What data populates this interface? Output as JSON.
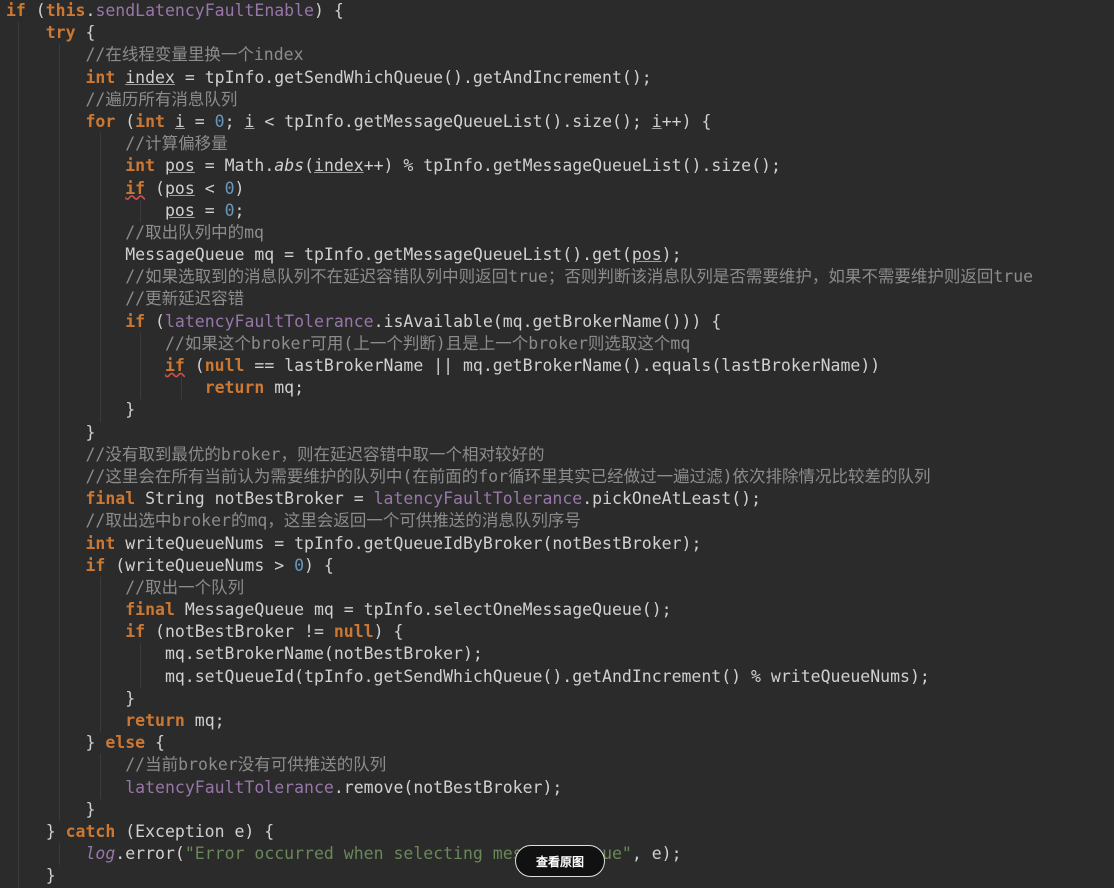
{
  "colors": {
    "background": "#2b2b2b",
    "keyword": "#cc7832",
    "field": "#9876aa",
    "number": "#6897bb",
    "string": "#6a8759",
    "comment": "#8c8c8c",
    "plain": "#d0d0d0"
  },
  "code": {
    "language": "java",
    "lines": [
      [
        {
          "t": "if",
          "c": "kw"
        },
        {
          "t": " ("
        },
        {
          "t": "this",
          "c": "kw"
        },
        {
          "t": "."
        },
        {
          "t": "sendLatencyFaultEnable",
          "c": "fld"
        },
        {
          "t": ") {"
        }
      ],
      [
        {
          "t": "    "
        },
        {
          "t": "try",
          "c": "kw"
        },
        {
          "t": " {"
        }
      ],
      [
        {
          "t": "        "
        },
        {
          "t": "//在线程变量里换一个index",
          "c": "cmt"
        }
      ],
      [
        {
          "t": "        "
        },
        {
          "t": "int",
          "c": "kw"
        },
        {
          "t": " "
        },
        {
          "t": "index",
          "c": "ul"
        },
        {
          "t": " = tpInfo.getSendWhichQueue().getAndIncrement();"
        }
      ],
      [
        {
          "t": "        "
        },
        {
          "t": "//遍历所有消息队列",
          "c": "cmt"
        }
      ],
      [
        {
          "t": "        "
        },
        {
          "t": "for",
          "c": "kw"
        },
        {
          "t": " ("
        },
        {
          "t": "int",
          "c": "kw"
        },
        {
          "t": " "
        },
        {
          "t": "i",
          "c": "ul"
        },
        {
          "t": " = "
        },
        {
          "t": "0",
          "c": "num"
        },
        {
          "t": "; "
        },
        {
          "t": "i",
          "c": "ul"
        },
        {
          "t": " < tpInfo.getMessageQueueList().size(); "
        },
        {
          "t": "i",
          "c": "ul"
        },
        {
          "t": "++) {"
        }
      ],
      [
        {
          "t": "            "
        },
        {
          "t": "//计算偏移量",
          "c": "cmt"
        }
      ],
      [
        {
          "t": "            "
        },
        {
          "t": "int",
          "c": "kw"
        },
        {
          "t": " "
        },
        {
          "t": "pos",
          "c": "ul"
        },
        {
          "t": " = Math."
        },
        {
          "t": "abs",
          "c": "ital"
        },
        {
          "t": "("
        },
        {
          "t": "index",
          "c": "ul"
        },
        {
          "t": "++) % tpInfo.getMessageQueueList().size();"
        }
      ],
      [
        {
          "t": "            "
        },
        {
          "t": "if",
          "c": "kw sq"
        },
        {
          "t": " ("
        },
        {
          "t": "pos",
          "c": "ul"
        },
        {
          "t": " < "
        },
        {
          "t": "0",
          "c": "num"
        },
        {
          "t": ")"
        }
      ],
      [
        {
          "t": "                "
        },
        {
          "t": "pos",
          "c": "ul"
        },
        {
          "t": " = "
        },
        {
          "t": "0",
          "c": "num"
        },
        {
          "t": ";"
        }
      ],
      [
        {
          "t": "            "
        },
        {
          "t": "//取出队列中的mq",
          "c": "cmt"
        }
      ],
      [
        {
          "t": "            "
        },
        {
          "t": "MessageQueue mq = tpInfo.getMessageQueueList().get("
        },
        {
          "t": "pos",
          "c": "ul"
        },
        {
          "t": ");"
        }
      ],
      [
        {
          "t": "            "
        },
        {
          "t": "//如果选取到的消息队列不在延迟容错队列中则返回true；否则判断该消息队列是否需要维护，如果不需要维护则返回true",
          "c": "cmt"
        }
      ],
      [
        {
          "t": "            "
        },
        {
          "t": "//更新延迟容错",
          "c": "cmt"
        }
      ],
      [
        {
          "t": "            "
        },
        {
          "t": "if",
          "c": "kw"
        },
        {
          "t": " ("
        },
        {
          "t": "latencyFaultTolerance",
          "c": "fld"
        },
        {
          "t": ".isAvailable(mq.getBrokerName())) {"
        }
      ],
      [
        {
          "t": "                "
        },
        {
          "t": "//如果这个broker可用(上一个判断)且是上一个broker则选取这个mq",
          "c": "cmt"
        }
      ],
      [
        {
          "t": "                "
        },
        {
          "t": "if",
          "c": "kw sq"
        },
        {
          "t": " ("
        },
        {
          "t": "null",
          "c": "kw"
        },
        {
          "t": " == lastBrokerName || mq.getBrokerName().equals(lastBrokerName))"
        }
      ],
      [
        {
          "t": "                    "
        },
        {
          "t": "return",
          "c": "kw"
        },
        {
          "t": " mq;"
        }
      ],
      [
        {
          "t": "            }"
        }
      ],
      [
        {
          "t": "        }"
        }
      ],
      [
        {
          "t": "        "
        },
        {
          "t": "//没有取到最优的broker，则在延迟容错中取一个相对较好的",
          "c": "cmt"
        }
      ],
      [
        {
          "t": "        "
        },
        {
          "t": "//这里会在所有当前认为需要维护的队列中(在前面的for循环里其实已经做过一遍过滤)依次排除情况比较差的队列",
          "c": "cmt"
        }
      ],
      [
        {
          "t": "        "
        },
        {
          "t": "final",
          "c": "kw"
        },
        {
          "t": " String notBestBroker = "
        },
        {
          "t": "latencyFaultTolerance",
          "c": "fld"
        },
        {
          "t": ".pickOneAtLeast();"
        }
      ],
      [
        {
          "t": "        "
        },
        {
          "t": "//取出选中broker的mq，这里会返回一个可供推送的消息队列序号",
          "c": "cmt"
        }
      ],
      [
        {
          "t": "        "
        },
        {
          "t": "int",
          "c": "kw"
        },
        {
          "t": " writeQueueNums = tpInfo.getQueueIdByBroker(notBestBroker);"
        }
      ],
      [
        {
          "t": "        "
        },
        {
          "t": "if",
          "c": "kw"
        },
        {
          "t": " (writeQueueNums > "
        },
        {
          "t": "0",
          "c": "num"
        },
        {
          "t": ") {"
        }
      ],
      [
        {
          "t": "            "
        },
        {
          "t": "//取出一个队列",
          "c": "cmt"
        }
      ],
      [
        {
          "t": "            "
        },
        {
          "t": "final",
          "c": "kw"
        },
        {
          "t": " MessageQueue mq = tpInfo.selectOneMessageQueue();"
        }
      ],
      [
        {
          "t": "            "
        },
        {
          "t": "if",
          "c": "kw"
        },
        {
          "t": " (notBestBroker != "
        },
        {
          "t": "null",
          "c": "kw"
        },
        {
          "t": ") {"
        }
      ],
      [
        {
          "t": "                mq.setBrokerName(notBestBroker);"
        }
      ],
      [
        {
          "t": "                mq.setQueueId(tpInfo.getSendWhichQueue().getAndIncrement() % writeQueueNums);"
        }
      ],
      [
        {
          "t": "            }"
        }
      ],
      [
        {
          "t": "            "
        },
        {
          "t": "return",
          "c": "kw"
        },
        {
          "t": " mq;"
        }
      ],
      [
        {
          "t": "        } "
        },
        {
          "t": "else",
          "c": "kw"
        },
        {
          "t": " {"
        }
      ],
      [
        {
          "t": "            "
        },
        {
          "t": "//当前broker没有可供推送的队列",
          "c": "cmt"
        }
      ],
      [
        {
          "t": "            "
        },
        {
          "t": "latencyFaultTolerance",
          "c": "fld"
        },
        {
          "t": ".remove(notBestBroker);"
        }
      ],
      [
        {
          "t": "        }"
        }
      ],
      [
        {
          "t": "    } "
        },
        {
          "t": "catch",
          "c": "kw"
        },
        {
          "t": " (Exception e) {"
        }
      ],
      [
        {
          "t": "        "
        },
        {
          "t": "log",
          "c": "fld ital"
        },
        {
          "t": ".error("
        },
        {
          "t": "\"Error occurred when selecting message queue\"",
          "c": "str"
        },
        {
          "t": ", e);"
        }
      ],
      [
        {
          "t": "    }"
        }
      ]
    ]
  },
  "overlay": {
    "view_original_label": "查看原图"
  }
}
